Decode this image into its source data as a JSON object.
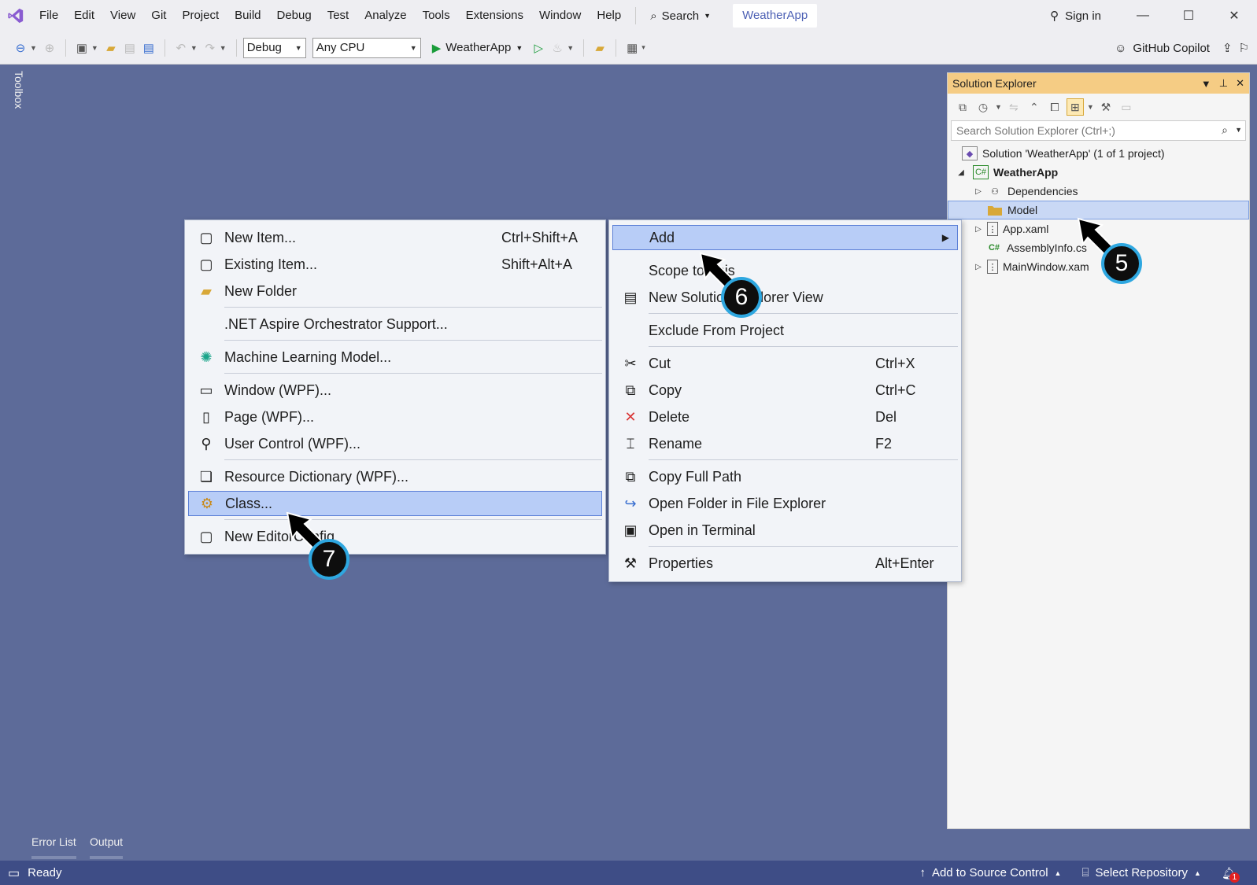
{
  "menubar": {
    "items": [
      "File",
      "Edit",
      "View",
      "Git",
      "Project",
      "Build",
      "Debug",
      "Test",
      "Analyze",
      "Tools",
      "Extensions",
      "Window",
      "Help"
    ],
    "search_label": "Search",
    "app_name": "WeatherApp",
    "sign_in": "Sign in"
  },
  "toolbar": {
    "config": "Debug",
    "platform": "Any CPU",
    "run_target": "WeatherApp",
    "copilot": "GitHub Copilot"
  },
  "toolbox": {
    "label": "Toolbox"
  },
  "solution_explorer": {
    "title": "Solution Explorer",
    "search_placeholder": "Search Solution Explorer (Ctrl+;)",
    "tree": [
      {
        "label": "Solution 'WeatherApp' (1 of 1 project)",
        "icon": "solution-icon"
      },
      {
        "label": "WeatherApp",
        "icon": "csharp-project-icon"
      },
      {
        "label": "Dependencies",
        "icon": "dependencies-icon"
      },
      {
        "label": "Model",
        "icon": "folder-icon"
      },
      {
        "label": "App.xaml",
        "icon": "xaml-file-icon"
      },
      {
        "label": "AssemblyInfo.cs",
        "icon": "csharp-file-icon"
      },
      {
        "label": "MainWindow.xaml",
        "icon": "xaml-file-icon"
      }
    ]
  },
  "add_submenu": {
    "items": [
      {
        "label": "New Item...",
        "shortcut": "Ctrl+Shift+A",
        "icon": "new-item-icon"
      },
      {
        "label": "Existing Item...",
        "shortcut": "Shift+Alt+A",
        "icon": "existing-item-icon"
      },
      {
        "label": "New Folder",
        "shortcut": "",
        "icon": "new-folder-icon"
      },
      {
        "label": ".NET Aspire Orchestrator Support...",
        "shortcut": "",
        "icon": ""
      },
      {
        "label": "Machine Learning Model...",
        "shortcut": "",
        "icon": "ml-model-icon"
      },
      {
        "label": "Window (WPF)...",
        "shortcut": "",
        "icon": "window-icon"
      },
      {
        "label": "Page (WPF)...",
        "shortcut": "",
        "icon": "page-icon"
      },
      {
        "label": "User Control (WPF)...",
        "shortcut": "",
        "icon": "user-control-icon"
      },
      {
        "label": "Resource Dictionary (WPF)...",
        "shortcut": "",
        "icon": "resource-dictionary-icon"
      },
      {
        "label": "Class...",
        "shortcut": "",
        "icon": "class-icon"
      },
      {
        "label": "New EditorConfig",
        "shortcut": "",
        "icon": "editorconfig-icon"
      }
    ]
  },
  "context_menu": {
    "items": [
      {
        "label": "Add",
        "shortcut": "",
        "icon": ""
      },
      {
        "label": "Scope to This",
        "shortcut": "",
        "icon": ""
      },
      {
        "label": "New Solution Explorer View",
        "shortcut": "",
        "icon": "new-view-icon"
      },
      {
        "label": "Exclude From Project",
        "shortcut": "",
        "icon": ""
      },
      {
        "label": "Cut",
        "shortcut": "Ctrl+X",
        "icon": "cut-icon"
      },
      {
        "label": "Copy",
        "shortcut": "Ctrl+C",
        "icon": "copy-icon"
      },
      {
        "label": "Delete",
        "shortcut": "Del",
        "icon": "delete-icon"
      },
      {
        "label": "Rename",
        "shortcut": "F2",
        "icon": "rename-icon"
      },
      {
        "label": "Copy Full Path",
        "shortcut": "",
        "icon": "copy-path-icon"
      },
      {
        "label": "Open Folder in File Explorer",
        "shortcut": "",
        "icon": "open-folder-icon"
      },
      {
        "label": "Open in Terminal",
        "shortcut": "",
        "icon": "terminal-icon"
      },
      {
        "label": "Properties",
        "shortcut": "Alt+Enter",
        "icon": "wrench-icon"
      }
    ]
  },
  "callouts": [
    "5",
    "6",
    "7"
  ],
  "bottom_tabs": [
    "Error List",
    "Output"
  ],
  "statusbar": {
    "status": "Ready",
    "source_control": "Add to Source Control",
    "repository": "Select Repository",
    "notifications": "1"
  },
  "colors": {
    "background": "#5d6b99",
    "statusbar": "#3e4d86",
    "solution_explorer_title": "#f5cc84",
    "highlight": "#b8cdf7",
    "callout_border": "#2ea7e0"
  }
}
